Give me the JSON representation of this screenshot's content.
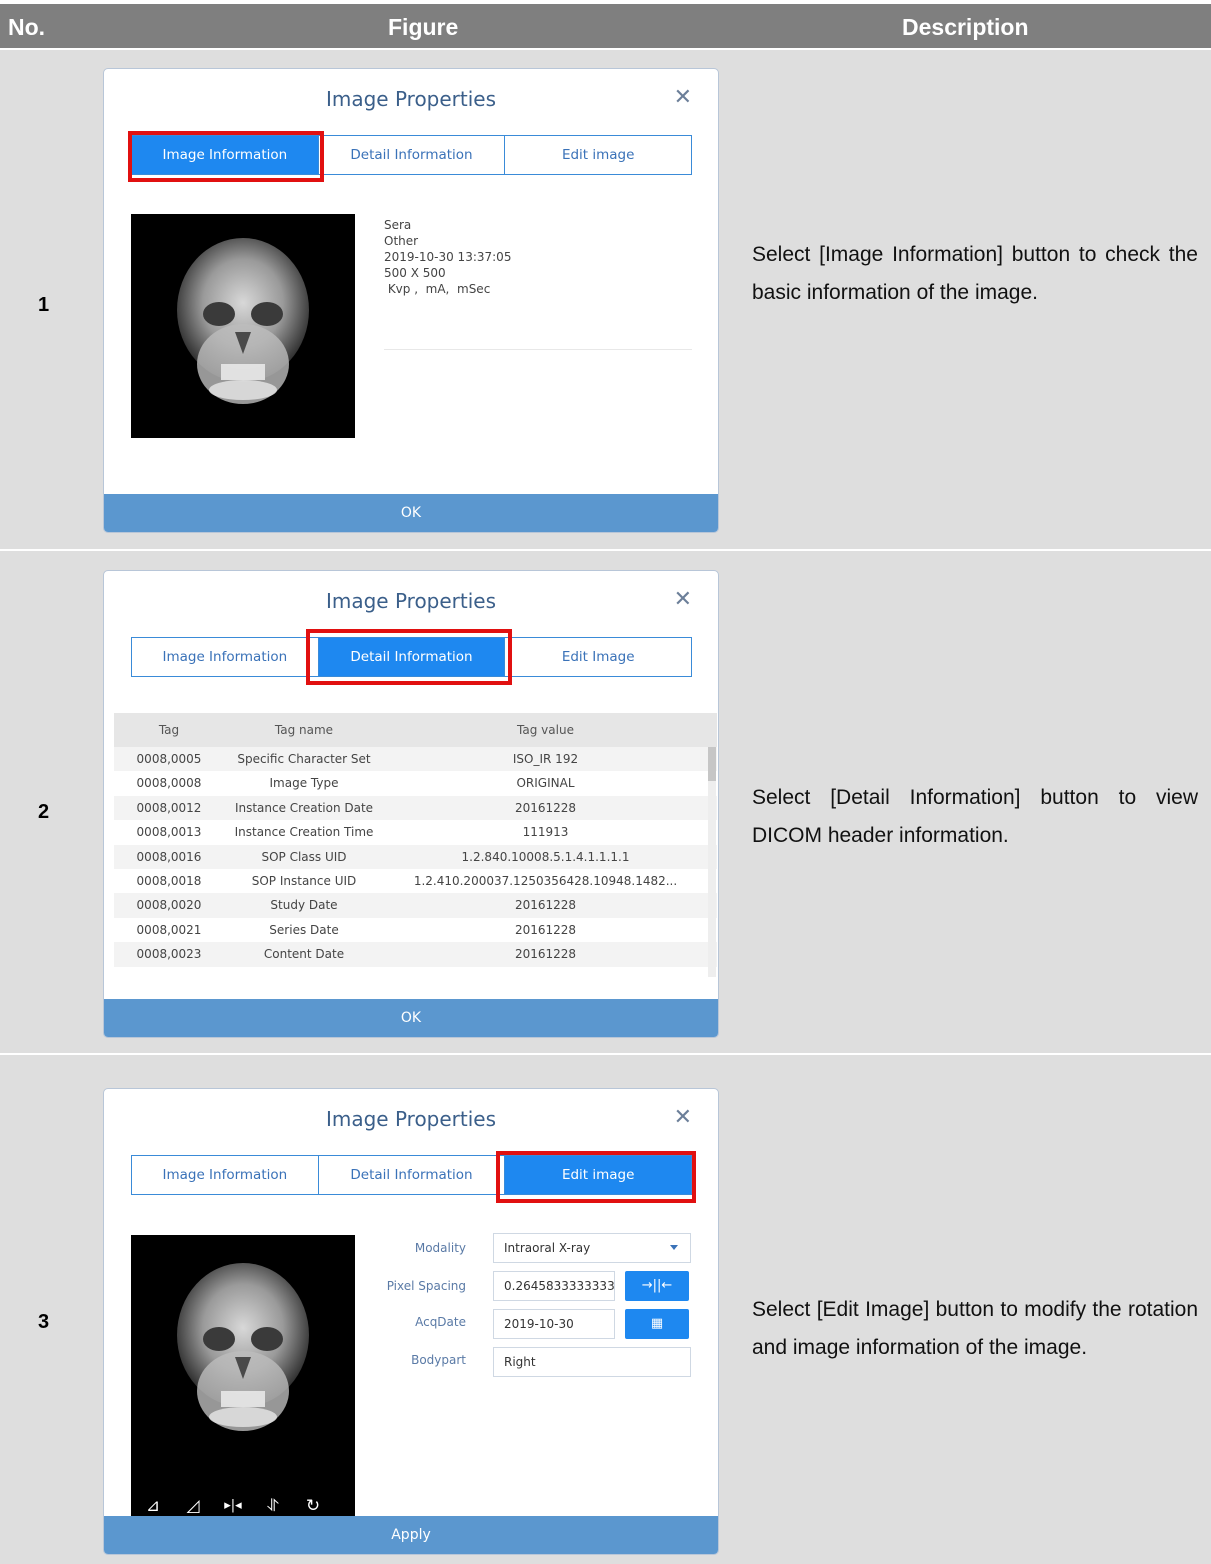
{
  "header": {
    "no": "No.",
    "figure": "Figure",
    "description": "Description"
  },
  "rows": [
    {
      "no": "1",
      "description": "Select [Image Information] button to check the basic information of the image.",
      "dialog": {
        "title": "Image Properties",
        "tabs": [
          "Image Information",
          "Detail Information",
          "Edit image"
        ],
        "info_lines": [
          "Sera",
          "Other",
          "2019-10-30 13:37:05",
          "500  X  500",
          " Kvp ,  mA,  mSec"
        ],
        "footer": "OK"
      }
    },
    {
      "no": "2",
      "description": "Select [Detail Information] button to view DICOM header information.",
      "dialog": {
        "title": "Image Properties",
        "tabs": [
          "Image Information",
          "Detail Information",
          "Edit Image"
        ],
        "columns": [
          "Tag",
          "Tag name",
          "Tag value"
        ],
        "table": [
          [
            "0008,0005",
            "Specific Character Set",
            "ISO_IR 192"
          ],
          [
            "0008,0008",
            "Image Type",
            "ORIGINAL"
          ],
          [
            "0008,0012",
            "Instance Creation Date",
            "20161228"
          ],
          [
            "0008,0013",
            "Instance Creation Time",
            "111913"
          ],
          [
            "0008,0016",
            "SOP Class UID",
            "1.2.840.10008.5.1.4.1.1.1.1"
          ],
          [
            "0008,0018",
            "SOP Instance UID",
            "1.2.410.200037.1250356428.10948.1482..."
          ],
          [
            "0008,0020",
            "Study Date",
            "20161228"
          ],
          [
            "0008,0021",
            "Series Date",
            "20161228"
          ],
          [
            "0008,0023",
            "Content Date",
            "20161228"
          ]
        ],
        "footer": "OK"
      }
    },
    {
      "no": "3",
      "description": "Select [Edit Image] button to modify the rotation and image information of the image.",
      "dialog": {
        "title": "Image Properties",
        "tabs": [
          "Image Information",
          "Detail Information",
          "Edit image"
        ],
        "fields": {
          "modality_label": "Modality",
          "modality_value": "Intraoral X-ray",
          "pixel_spacing_label": "Pixel Spacing",
          "pixel_spacing_value": "0.2645833333333",
          "pixel_spacing_button": "→||←",
          "acqdate_label": "AcqDate",
          "acqdate_value": "2019-10-30",
          "bodypart_label": "Bodypart",
          "bodypart_value": "Right"
        },
        "tools": [
          "rotate-left-icon",
          "rotate-right-icon",
          "flip-horizontal-icon",
          "flip-vertical-icon",
          "reset-rotation-icon"
        ],
        "footer": "Apply"
      }
    }
  ]
}
